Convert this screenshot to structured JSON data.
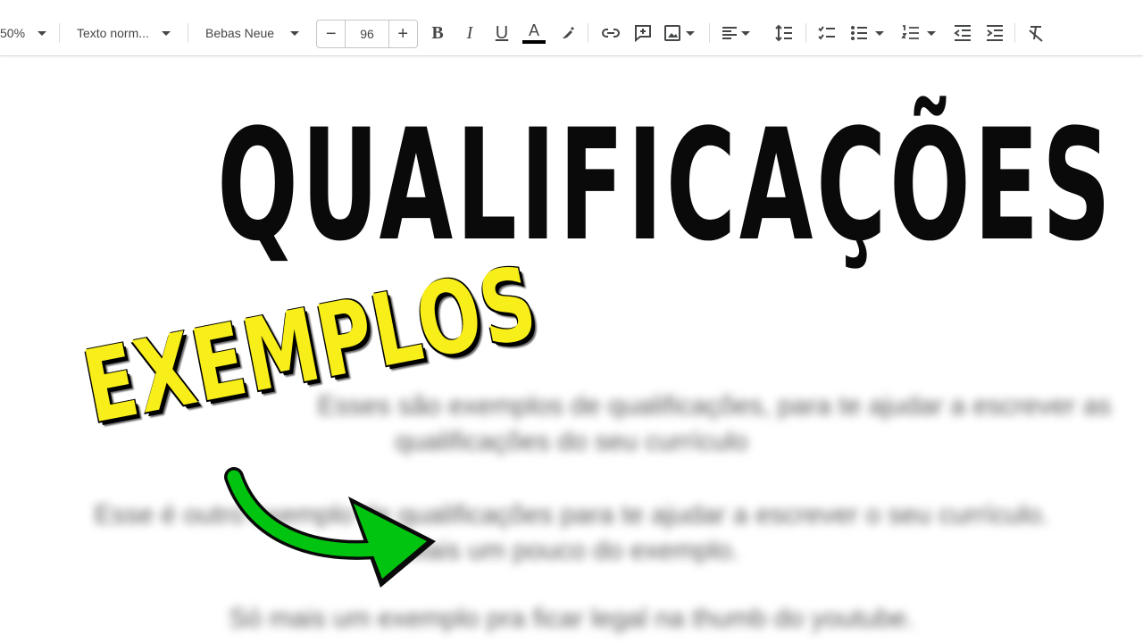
{
  "toolbar": {
    "zoom": "50%",
    "style": "Texto norm...",
    "font": "Bebas Neue",
    "font_size": "96",
    "minus": "−",
    "plus": "+",
    "bold": "B",
    "italic": "I",
    "underline": "U",
    "text_color": "A"
  },
  "document": {
    "heading": "QUALIFICAÇÕES",
    "line1": "Esses são exemplos de qualificações, para te ajudar a escrever as",
    "line2": "qualificações do seu currículo",
    "line3": "Esse é outro exemplo de qualificações para te ajudar a escrever o seu currículo.",
    "line4": "Mais um pouco do exemplo.",
    "line5": "Só mais um exemplo pra ficar legal na thumb do youtube."
  },
  "overlay": {
    "label": "EXEMPLOS",
    "label_color": "#f7ee1a",
    "arrow_color": "#00c40f"
  }
}
